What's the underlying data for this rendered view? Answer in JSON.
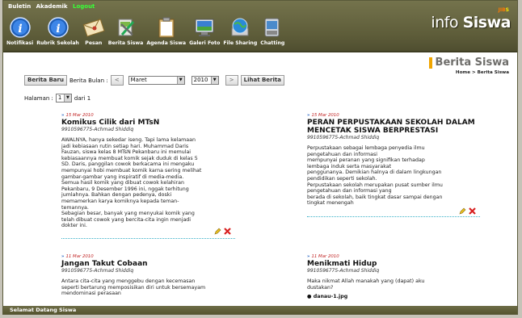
{
  "topmenu": {
    "buletin": "Buletin",
    "akademik": "Akademik",
    "logout": "Logout"
  },
  "brand": {
    "jib": "JIB",
    "jib_s": "S",
    "logo_a": "info ",
    "logo_b": "Siswa"
  },
  "nav": [
    {
      "label": "Notifikasi",
      "icon": "info-circle-icon"
    },
    {
      "label": "Rubrik Sekolah",
      "icon": "info-circle-icon"
    },
    {
      "label": "Pesan",
      "icon": "envelope-icon"
    },
    {
      "label": "Berita Siswa",
      "icon": "tools-icon"
    },
    {
      "label": "Agenda Siswa",
      "icon": "clipboard-icon"
    },
    {
      "label": "Galeri Foto",
      "icon": "monitor-icon"
    },
    {
      "label": "File Sharing",
      "icon": "globe-icon"
    },
    {
      "label": "Chatting",
      "icon": "chat-icon"
    }
  ],
  "page": {
    "title": "Berita Siswa",
    "crumb_home": "Home",
    "crumb_sep": ">",
    "crumb_current": "Berita Siswa"
  },
  "filters": {
    "new_btn": "Berita Baru",
    "month_label": "Berita Bulan :",
    "prev": "<",
    "month": "Maret",
    "year": "2010",
    "next": ">",
    "view_btn": "Lihat Berita"
  },
  "paging": {
    "label": "Halaman :",
    "page": "1",
    "suffix": "dari 1"
  },
  "articles": [
    {
      "date": "15 Mar 2010",
      "title": "Komikus Cilik dari MTsN",
      "author": "9910596775-Achmad Shiddiq",
      "body": "AWALNYA, hanya sekedar iseng. Tapi lama kelamaan\njadi kebiasaan rutin setiap hari. Muhammad Daris\nFauzan, siswa kelas 8 MTsN Pekanbaru ini  memulai\nkebiasaannya membuat komik sejak duduk di kelas 5\nSD. Daris, panggilan cowok berkacama ini mengaku\nmempunyai hobi membuat komik  karna sering melihat\ngambar-gambar yang inspiratif di media-media.\nSemua hasil komik yang dibuat cowok kelahiran\nPekanbaru, 9 Desember 1996 ini, nggak terhitung\njumlahnya. Bahkan dengan pedenya, doski\nmemamerkan karya komiknya kepada teman-\ntemannya.\nSebagian besar, banyak yang menyukai  komik yang\ntelah dibuat cowok yang bercita-cita ingin menjadi\ndokter ini."
    },
    {
      "date": "15 Mar 2010",
      "title": "PERAN PERPUSTAKAAN SEKOLAH DALAM MENCETAK SISWA BERPRESTASI",
      "author": "9910596775-Achmad Shiddiq",
      "body": "Perpustakaan sebagai lembaga penyedia ilmu\npengetahuan dan informasi\nmempunyai peranan yang signifikan terhadap\nlembaga induk serta masyarakat\npenggunanya. Demikian halnya di dalam lingkungan\npendidikan seperti sekolah.\nPerpustakaan sekolah merupakan pusat sumber ilmu\npengetahuan dan informasi yang\nberada di sekolah, baik tingkat dasar sampai dengan\ntingkat menengah"
    },
    {
      "date": "11 Mar 2010",
      "title": "Jangan Takut Cobaan",
      "author": "9910596775-Achmad Shiddiq",
      "body": "Antara cita-cita yang menggebu dengan kecemasan\nseperti bertarung memposisikan diri untuk bersemayam\nmendominasi perasaan"
    },
    {
      "date": "11 Mar 2010",
      "title": "Menikmati Hidup",
      "author": "9910596775-Achmad Shiddiq",
      "body": "Maka nikmat Allah manakah yang (dapat) aku\ndustakan?",
      "attachment": "danau-1.jpg"
    }
  ],
  "footer": {
    "text": "Selamat Datang Siswa"
  },
  "colors": {
    "header": "#5d5c39",
    "accent": "#f0a500",
    "date": "#c02020",
    "divider": "#3ab0c8"
  }
}
